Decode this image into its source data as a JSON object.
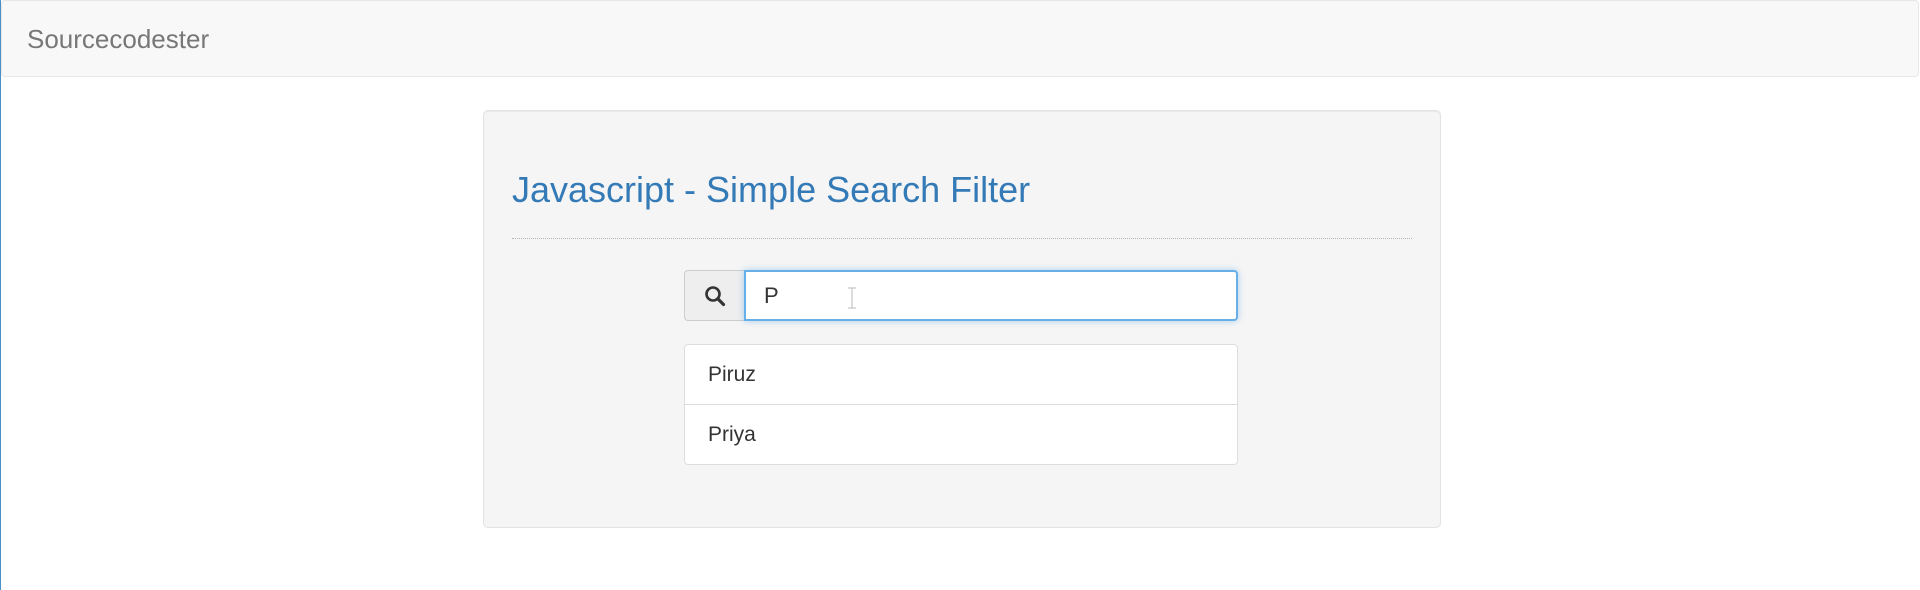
{
  "navbar": {
    "brand": "Sourcecodester"
  },
  "main": {
    "title": "Javascript - Simple Search Filter",
    "search": {
      "icon": "search-icon",
      "value": "P",
      "placeholder": ""
    },
    "results": [
      {
        "label": "Piruz"
      },
      {
        "label": "Priya"
      }
    ]
  },
  "colors": {
    "title": "#337ab7",
    "focus_border": "#66afe9",
    "navbar_bg": "#f8f8f8",
    "well_bg": "#f5f5f5"
  }
}
